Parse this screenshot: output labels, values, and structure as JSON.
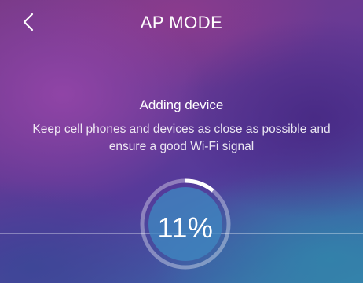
{
  "header": {
    "title": "AP MODE",
    "back_icon": "chevron-left-icon"
  },
  "status": {
    "title": "Adding device",
    "hint": "Keep cell phones and devices as close as possible and ensure a good Wi-Fi signal"
  },
  "progress": {
    "percent": 11,
    "label": "11%",
    "ring_color": "#ffffff",
    "disc_color": "#3f86c0"
  }
}
